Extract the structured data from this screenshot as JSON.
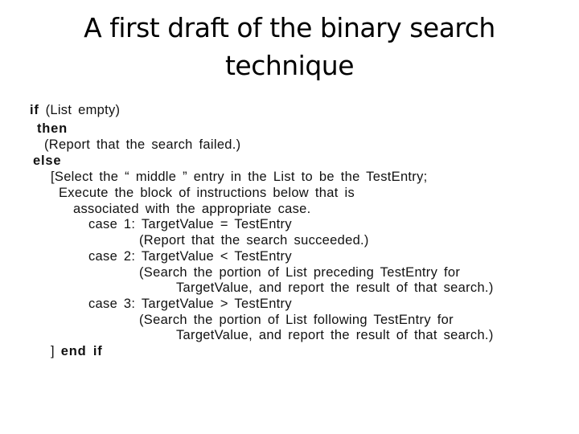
{
  "slide": {
    "title_line1": "A first draft of the binary search",
    "title_line2": "technique"
  },
  "pseudocode": {
    "if_kw": "if",
    "if_cond": " (List empty)",
    "then_kw": "then",
    "then_action": "(Report that the search failed.)",
    "else_kw": "else",
    "select_line": "[Select the “ middle ” entry in the List to be the TestEntry;",
    "execute_line": "Execute the block of instructions below that is",
    "associated_line": "associated with the appropriate case.",
    "case1_line": "case 1: TargetValue = TestEntry",
    "case1_action": "(Report that the search succeeded.)",
    "case2_line": "case 2: TargetValue < TestEntry",
    "case2_action1": "(Search the portion of List preceding TestEntry for",
    "case2_action2": "TargetValue, and report the result of that search.)",
    "case3_line": "case 3: TargetValue > TestEntry",
    "case3_action1": "(Search the portion of List following TestEntry for",
    "case3_action2": "TargetValue, and report the result of that search.)",
    "end_bracket": "] ",
    "end_kw": "end if"
  }
}
